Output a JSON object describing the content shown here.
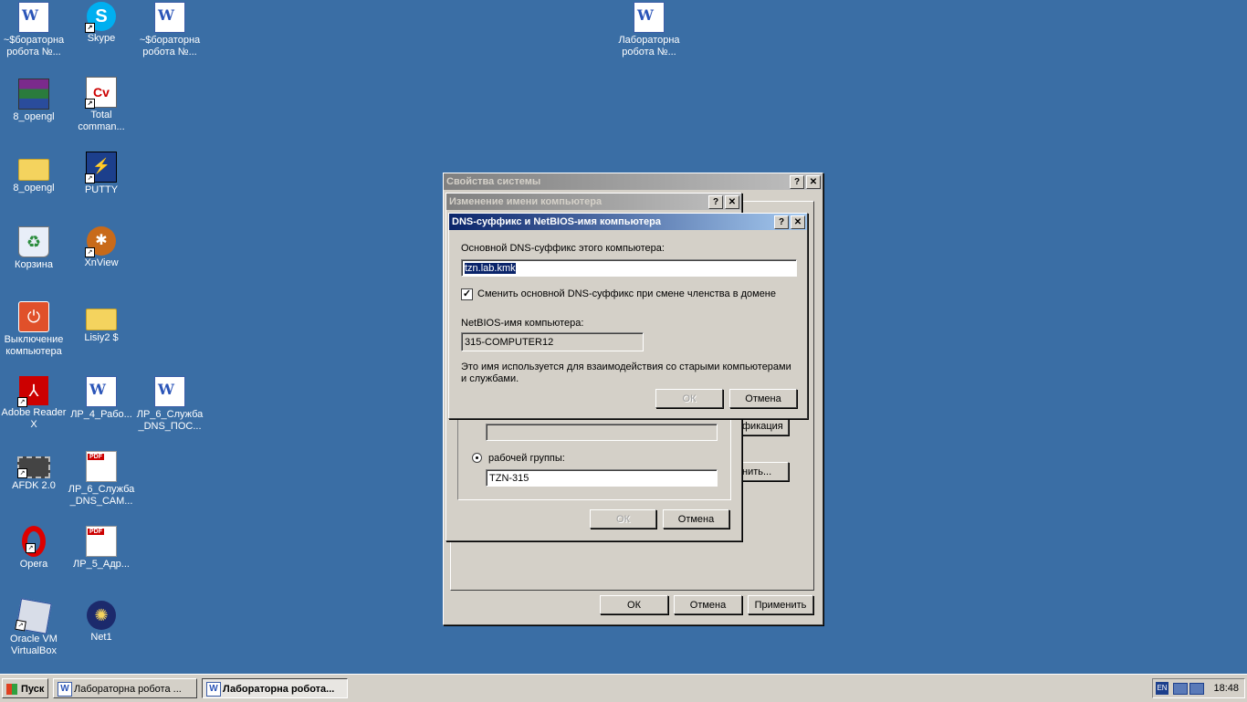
{
  "desktop": {
    "icons": [
      {
        "label": "~$бораторна робота №...",
        "icon": "word-doc-icon"
      },
      {
        "label": "Skype",
        "icon": "skype-icon"
      },
      {
        "label": "~$бораторна робота №...",
        "icon": "word-doc-icon"
      },
      {
        "label": "Лабораторна робота №...",
        "icon": "word-doc-icon"
      },
      {
        "label": "8_opengl",
        "icon": "winrar-archive-icon"
      },
      {
        "label": "Total comman...",
        "icon": "total-commander-icon"
      },
      {
        "label": "8_opengl",
        "icon": "folder-icon"
      },
      {
        "label": "PUTTY",
        "icon": "putty-icon"
      },
      {
        "label": "Корзина",
        "icon": "recycle-bin-icon"
      },
      {
        "label": "XnView",
        "icon": "xnview-icon"
      },
      {
        "label": "Выключение компьютера",
        "icon": "shutdown-icon"
      },
      {
        "label": "Lisiy2 $",
        "icon": "folder-icon"
      },
      {
        "label": "Adobe Reader X",
        "icon": "adobe-reader-icon"
      },
      {
        "label": "ЛР_4_Рабо...",
        "icon": "word-doc-icon"
      },
      {
        "label": "ЛР_6_Служба _DNS_ПОС...",
        "icon": "word-doc-icon"
      },
      {
        "label": "AFDK 2.0",
        "icon": "chip-icon"
      },
      {
        "label": "ЛР_6_Служба _DNS_САМ...",
        "icon": "pdf-icon"
      },
      {
        "label": "Opera",
        "icon": "opera-icon"
      },
      {
        "label": "ЛР_5_Адр...",
        "icon": "pdf-icon"
      },
      {
        "label": "Oracle VM VirtualBox",
        "icon": "virtualbox-icon"
      },
      {
        "label": "Net1",
        "icon": "net1-icon"
      }
    ]
  },
  "sysprops": {
    "title": "Свойства системы",
    "help": "?",
    "close": "✕",
    "ok": "ОК",
    "cancel": "Отмена",
    "apply": "Применить",
    "partial_ident": "фикация",
    "partial_change": "нить..."
  },
  "rename": {
    "title": "Изменение имени компьютера",
    "help": "?",
    "close": "✕",
    "workgroup_label": "рабочей группы:",
    "workgroup_value": "TZN-315",
    "domain_value": "",
    "ok": "ОК",
    "cancel": "Отмена"
  },
  "dns": {
    "title": "DNS-суффикс и NetBIOS-имя компьютера",
    "help": "?",
    "close": "✕",
    "suffix_label": "Основной DNS-суффикс этого компьютера:",
    "suffix_value": "tzn.lab.kmk",
    "checkbox_label": "Сменить основной DNS-суффикс при смене членства в домене",
    "checkbox_checked": true,
    "netbios_label": "NetBIOS-имя компьютера:",
    "netbios_value": "315-COMPUTER12",
    "note_line1": "Это имя используется для взаимодействия со старыми компьютерами",
    "note_line2": "и службами.",
    "ok": "ОК",
    "cancel": "Отмена"
  },
  "taskbar": {
    "start": "Пуск",
    "tasks": [
      {
        "label": "Лабораторна робота ...",
        "active": false
      },
      {
        "label": "Лабораторна робота...",
        "active": true
      }
    ],
    "lang": "EN",
    "clock": "18:48"
  }
}
